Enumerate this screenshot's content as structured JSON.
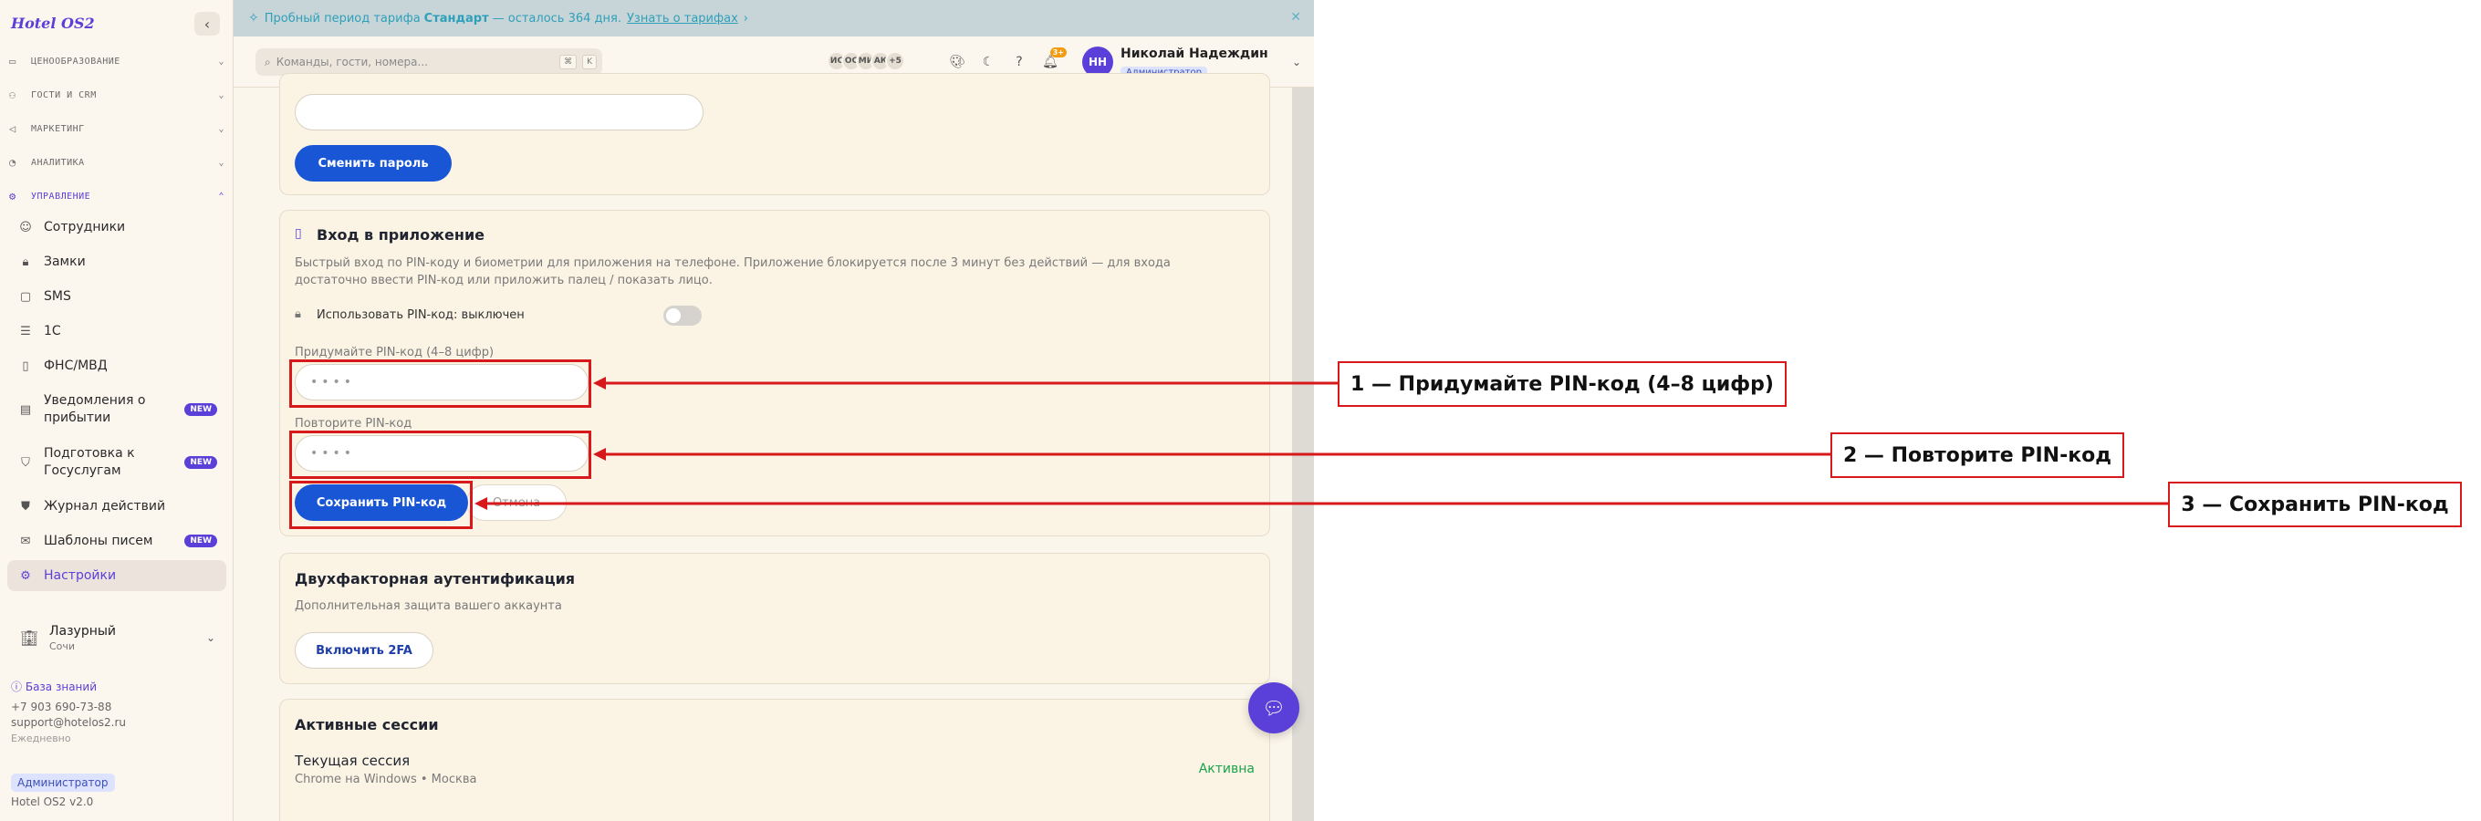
{
  "sidebar": {
    "logo": "Hotel OS2",
    "sections": [
      {
        "label": "ЦЕНООБРАЗОВАНИЕ",
        "icon": "wallet-icon"
      },
      {
        "label": "ГОСТИ И CRM",
        "icon": "users-icon"
      },
      {
        "label": "МАРКЕТИНГ",
        "icon": "megaphone-icon"
      },
      {
        "label": "АНАЛИТИКА",
        "icon": "chart-icon"
      },
      {
        "label": "УПРАВЛЕНИЕ",
        "icon": "gear-icon"
      }
    ],
    "items": [
      {
        "label": "Сотрудники",
        "icon": "user-check-icon"
      },
      {
        "label": "Замки",
        "icon": "lock-icon"
      },
      {
        "label": "SMS",
        "icon": "message-icon"
      },
      {
        "label": "1С",
        "icon": "database-icon"
      },
      {
        "label": "ФНС/МВД",
        "icon": "file-icon"
      },
      {
        "label": "Уведомления о прибытии",
        "icon": "document-icon",
        "badge": "NEW"
      },
      {
        "label": "Подготовка к Госуслугам",
        "icon": "shield-icon",
        "badge": "NEW"
      },
      {
        "label": "Журнал действий",
        "icon": "shield-alert-icon"
      },
      {
        "label": "Шаблоны писем",
        "icon": "mail-icon",
        "badge": "NEW"
      },
      {
        "label": "Настройки",
        "icon": "gear-icon"
      }
    ],
    "hotel": {
      "name": "Лазурный",
      "city": "Сочи"
    },
    "knowledge_base": "База знаний",
    "phone": "+7 903 690-73-88",
    "email": "support@hotelos2.ru",
    "schedule": "Ежедневно",
    "role": "Администратор",
    "version": "Hotel OS2 v2.0"
  },
  "banner": {
    "text_before": "Пробный период тарифа",
    "plan": "Стандарт",
    "text_after": "— осталось 364 дня.",
    "link": "Узнать о тарифах"
  },
  "topbar": {
    "search_placeholder": "Команды, гости, номера...",
    "shortcut_keys": [
      "⌘",
      "K"
    ],
    "staff_avatars": [
      "ИС",
      "ОС",
      "МИ",
      "АК",
      "+5"
    ],
    "notifications_count": "3+",
    "user": {
      "initials": "НН",
      "name": "Николай Надеждин",
      "role": "Администратор"
    }
  },
  "password_card": {
    "change_password_button": "Сменить пароль"
  },
  "pin_card": {
    "title": "Вход в приложение",
    "description": "Быстрый вход по PIN-коду и биометрии для приложения на телефоне. Приложение блокируется после 3 минут без действий — для входа достаточно ввести PIN-код или приложить палец / показать лицо.",
    "toggle_label": "Использовать PIN-код: выключен",
    "toggle_on": false,
    "pin_label": "Придумайте PIN-код (4–8 цифр)",
    "pin_placeholder": "••••",
    "repeat_label": "Повторите PIN-код",
    "repeat_placeholder": "••••",
    "save_button": "Сохранить PIN-код",
    "cancel_button": "Отмена"
  },
  "twofa_card": {
    "title": "Двухфакторная аутентификация",
    "description": "Дополнительная защита вашего аккаунта",
    "enable_button": "Включить 2FA"
  },
  "sessions_card": {
    "title": "Активные сессии",
    "current_session": "Текущая сессия",
    "device": "Chrome на Windows • Москва",
    "status": "Активна"
  },
  "annotations": [
    {
      "label": "1 — Придумайте PIN-код (4–8 цифр)"
    },
    {
      "label": "2 — Повторите PIN-код"
    },
    {
      "label": "3 — Сохранить PIN-код"
    }
  ],
  "colors": {
    "accent": "#5b3fd9",
    "primary_button": "#1856d6",
    "annotation": "#d7191c",
    "status_active": "#16a34a",
    "banner_bg": "#c7d5d8"
  }
}
